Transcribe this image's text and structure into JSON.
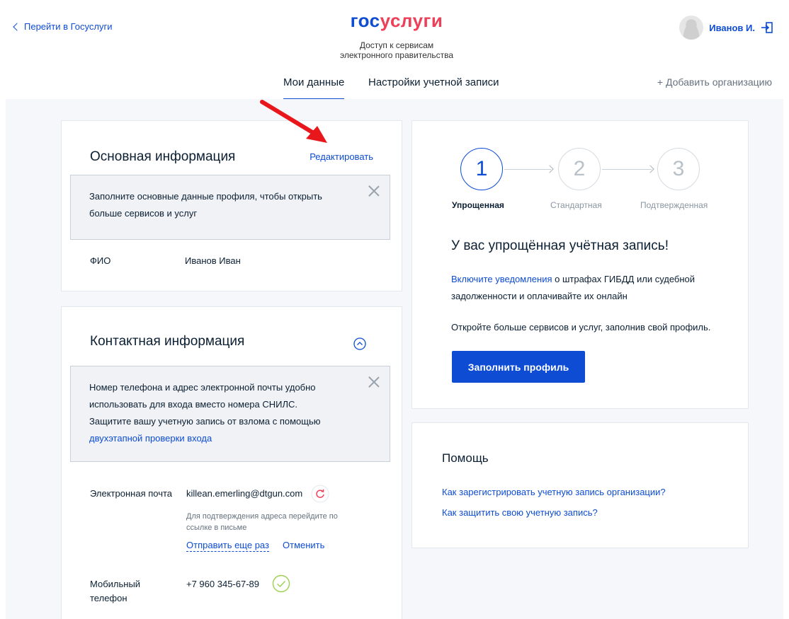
{
  "header": {
    "back_link": "Перейти в Госуслуги",
    "logo_gos": "гос",
    "logo_uslugi": "услуги",
    "logo_subtitle_line1": "Доступ к сервисам",
    "logo_subtitle_line2": "электронного правительства",
    "user_name": "Иванов И."
  },
  "tabs": {
    "my_data": "Мои данные",
    "settings": "Настройки учетной записи",
    "add_org": "+ Добавить организацию"
  },
  "basic_info": {
    "title": "Основная информация",
    "edit_link": "Редактировать",
    "notice_line1": "Заполните основные данные профиля, чтобы открыть",
    "notice_line2": "больше сервисов и услуг",
    "fio_label": "ФИО",
    "fio_value": "Иванов Иван"
  },
  "contact_info": {
    "title": "Контактная информация",
    "notice_line1": "Номер телефона и адрес электронной почты удобно",
    "notice_line2": "использовать для входа вместо номера СНИЛС.",
    "notice_line3": "Защитите вашу учетную запись от взлома с помощью",
    "notice_link": "двухэтапной проверки входа",
    "email_label": "Электронная почта",
    "email_value": "killean.emerling@dtgun.com",
    "email_hint_line1": "Для подтверждения адреса перейдите по",
    "email_hint_line2": "ссылке в письме",
    "resend_link": "Отправить еще раз",
    "cancel_link": "Отменить",
    "phone_label_line1": "Мобильный",
    "phone_label_line2": "телефон",
    "phone_value": "+7 960 345-67-89"
  },
  "account_level": {
    "steps": [
      {
        "number": "1",
        "label": "Упрощенная",
        "active": true
      },
      {
        "number": "2",
        "label": "Стандартная",
        "active": false
      },
      {
        "number": "3",
        "label": "Подтвержденная",
        "active": false
      }
    ],
    "title": "У вас упрощённая учётная запись!",
    "notify_link": "Включите уведомления",
    "notify_text_line1_rest": " о штрафах ГИБДД или судебной",
    "notify_text_line2": "задолженности и оплачивайте их онлайн",
    "profile_text": "Откройте больше сервисов и услуг, заполнив свой профиль.",
    "fill_button": "Заполнить профиль"
  },
  "help": {
    "title": "Помощь",
    "links": [
      "Как зарегистрировать учетную запись организации?",
      "Как защитить свою учетную запись?"
    ]
  },
  "colors": {
    "brand_blue": "#0d4cd3",
    "brand_red": "#ee3f58",
    "annotation_red": "#e8171b",
    "success_green": "#9bd14e"
  }
}
